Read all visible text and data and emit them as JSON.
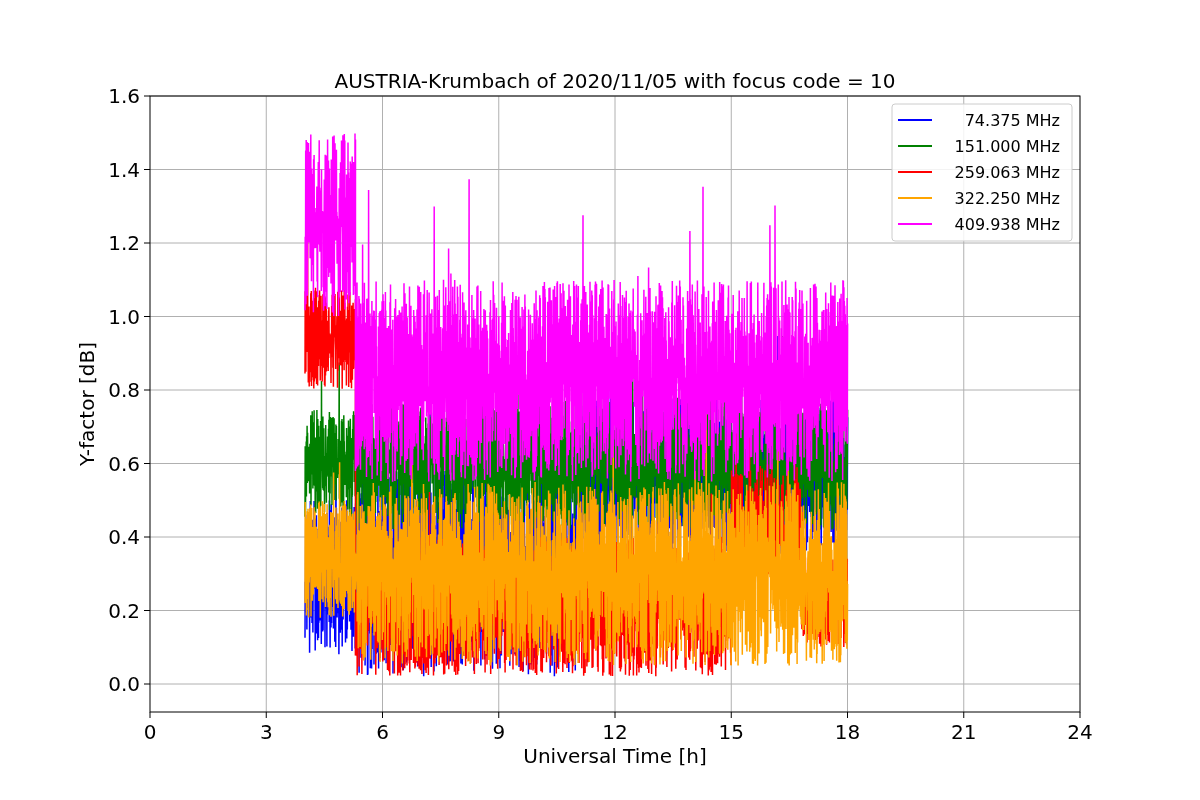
{
  "chart": {
    "title": "AUSTRIA-Krumbach of 2020/11/05 with focus code = 10",
    "xlabel": "Universal Time [h]",
    "ylabel": "Y-factor [dB]",
    "xticks": [
      "0",
      "3",
      "6",
      "9",
      "12",
      "15",
      "18",
      "21",
      "24"
    ],
    "yticks": [
      "1.6",
      "1.4",
      "1.2",
      "1.0",
      "0.8",
      "0.6",
      "0.4",
      "0.2",
      "0.0"
    ],
    "legend": [
      {
        "label": "74.375 MHz",
        "color": "#0000ff"
      },
      {
        "label": "151.000 MHz",
        "color": "#008000"
      },
      {
        "label": "259.063 MHz",
        "color": "#ff0000"
      },
      {
        "label": "322.250 MHz",
        "color": "#ffa500"
      },
      {
        "label": "409.938 MHz",
        "color": "#ff00ff"
      }
    ]
  }
}
